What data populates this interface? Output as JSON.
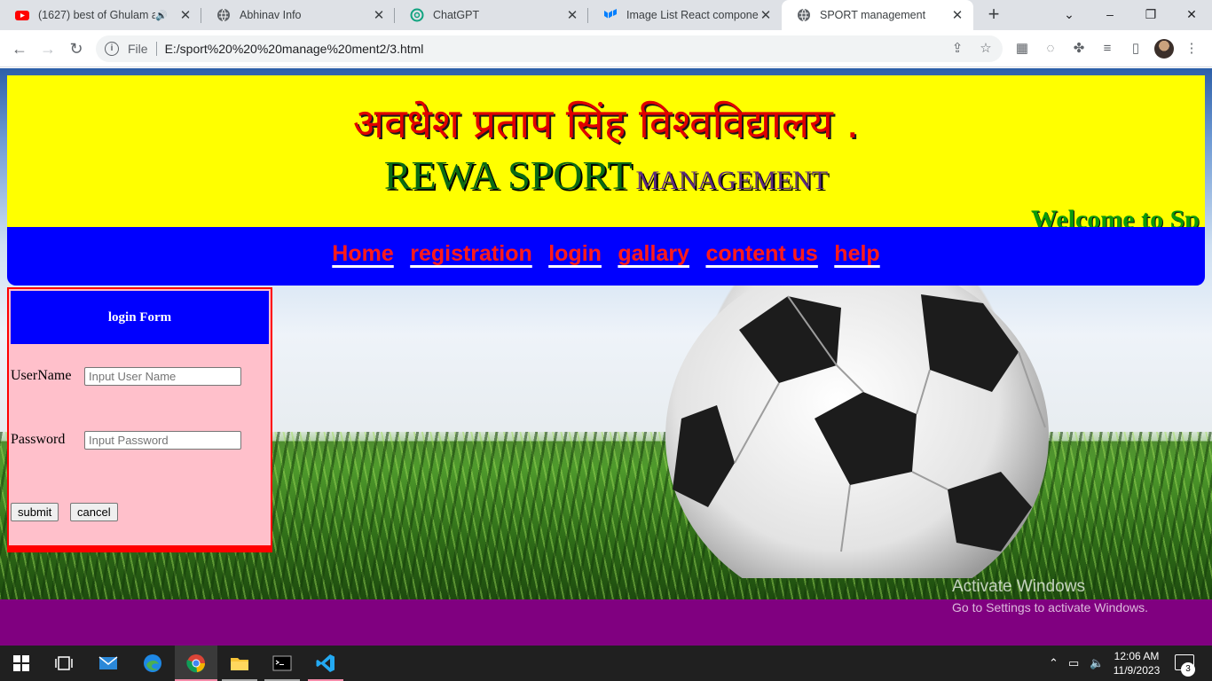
{
  "browser": {
    "tabs": [
      {
        "title": "(1627) best of Ghulam a",
        "icon": "youtube-icon",
        "audio": true
      },
      {
        "title": "Abhinav Info",
        "icon": "globe-icon"
      },
      {
        "title": "ChatGPT",
        "icon": "chatgpt-icon"
      },
      {
        "title": "Image List React component",
        "icon": "mui-icon"
      },
      {
        "title": "SPORT management",
        "icon": "globe-icon",
        "active": true
      }
    ],
    "new_tab": "+",
    "window_controls": {
      "minimize": "–",
      "restore": "❐",
      "close": "✕",
      "tab_search": "⌄"
    },
    "nav": {
      "back": "←",
      "forward": "→",
      "reload": "↻"
    },
    "address": {
      "scheme": "File",
      "url": "E:/sport%20%20%20manage%20ment2/3.html"
    }
  },
  "page": {
    "hindi_title": "अवधेश प्रताप सिंह विश्वविद्यालय .",
    "site_title_big": "REWA SPORT",
    "site_title_small": "MANAGEMENT",
    "marquee": "Welcome to Sp",
    "colors": {
      "header": "#ffff00",
      "navbar": "#0000ff",
      "nav_link": "#ff1a1a",
      "login_bg": "#ffc0cb",
      "footer": "#800080"
    },
    "nav_links": [
      "Home",
      "registration",
      "login",
      "gallary",
      "content us",
      "help"
    ],
    "login_form": {
      "heading": "login Form",
      "username_label": "UserName",
      "username_placeholder": "Input User Name",
      "password_label": "Password",
      "password_placeholder": "Input Password",
      "submit_label": "submit",
      "cancel_label": "cancel"
    }
  },
  "watermark": {
    "line1": "Activate Windows",
    "line2": "Go to Settings to activate Windows."
  },
  "taskbar": {
    "apps": [
      "windows-start-icon",
      "task-view-icon",
      "mail-icon",
      "edge-icon",
      "chrome-icon",
      "file-explorer-icon",
      "terminal-icon",
      "vscode-icon"
    ],
    "time": "12:06 AM",
    "date": "11/9/2023",
    "notifications": "3"
  }
}
